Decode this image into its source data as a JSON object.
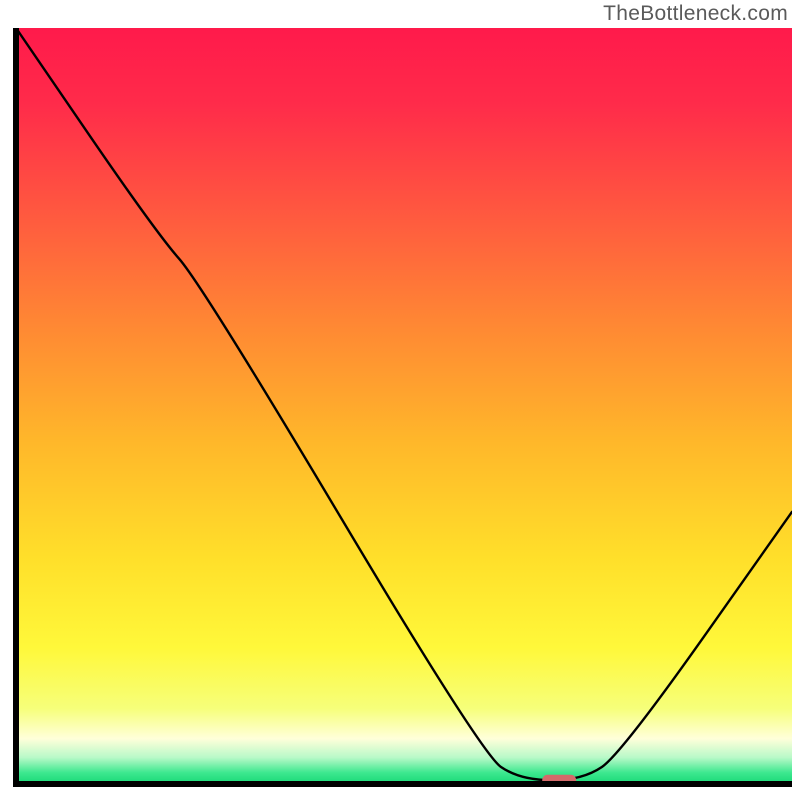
{
  "watermark": "TheBottleneck.com",
  "chart_data": {
    "type": "line",
    "title": "",
    "xlabel": "",
    "ylabel": "",
    "x_range": [
      0,
      100
    ],
    "y_range": [
      0,
      100
    ],
    "curve": [
      {
        "x": 0,
        "y": 100
      },
      {
        "x": 18,
        "y": 73
      },
      {
        "x": 24,
        "y": 66
      },
      {
        "x": 60,
        "y": 4
      },
      {
        "x": 65,
        "y": 0.5
      },
      {
        "x": 73,
        "y": 0.5
      },
      {
        "x": 78,
        "y": 4
      },
      {
        "x": 100,
        "y": 36
      }
    ],
    "marker": {
      "x": 70,
      "y": 0.5,
      "color": "#d46a6a",
      "rx": 12,
      "ry": 4
    },
    "gradient_stops": [
      {
        "offset": 0.0,
        "color": "#ff1a4b"
      },
      {
        "offset": 0.1,
        "color": "#ff2b4a"
      },
      {
        "offset": 0.25,
        "color": "#ff5a3f"
      },
      {
        "offset": 0.4,
        "color": "#ff8a33"
      },
      {
        "offset": 0.55,
        "color": "#ffb82a"
      },
      {
        "offset": 0.7,
        "color": "#ffdf2a"
      },
      {
        "offset": 0.82,
        "color": "#fff83a"
      },
      {
        "offset": 0.9,
        "color": "#f6ff7a"
      },
      {
        "offset": 0.94,
        "color": "#ffffda"
      },
      {
        "offset": 0.965,
        "color": "#b8f9c8"
      },
      {
        "offset": 0.985,
        "color": "#3de88f"
      },
      {
        "offset": 1.0,
        "color": "#17d876"
      }
    ],
    "axis_color": "#000000",
    "line_color": "#000000"
  }
}
